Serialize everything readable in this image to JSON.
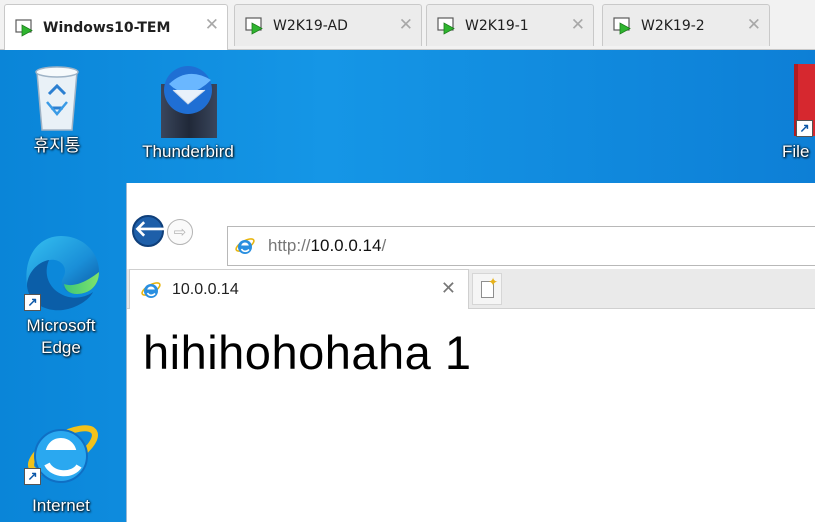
{
  "vm_tabs": [
    {
      "label": "Windows10-TEM",
      "active": true
    },
    {
      "label": "W2K19-AD",
      "active": false
    },
    {
      "label": "W2K19-1",
      "active": false
    },
    {
      "label": "W2K19-2",
      "active": false
    }
  ],
  "tab_close_glyph": "✕",
  "desktop": {
    "icons": {
      "recycle_bin": "휴지통",
      "thunderbird": "Thunderbird",
      "file_partial": "File",
      "edge_line1": "Microsoft",
      "edge_line2": "Edge",
      "ie": "Internet"
    },
    "shortcut_glyph": "↗"
  },
  "browser": {
    "back_glyph": "🡐",
    "forward_glyph": "⇨",
    "url_scheme": "http://",
    "url_host": "10.0.0.14",
    "url_trail": "/",
    "tab_title": "10.0.0.14",
    "tab_close": "✕",
    "page_heading": "hihihohohaha 1"
  },
  "colors": {
    "desktop_blue": "#0a85d8",
    "vm_play_green": "#2fb52f",
    "back_button_blue": "#1e5fa9"
  }
}
